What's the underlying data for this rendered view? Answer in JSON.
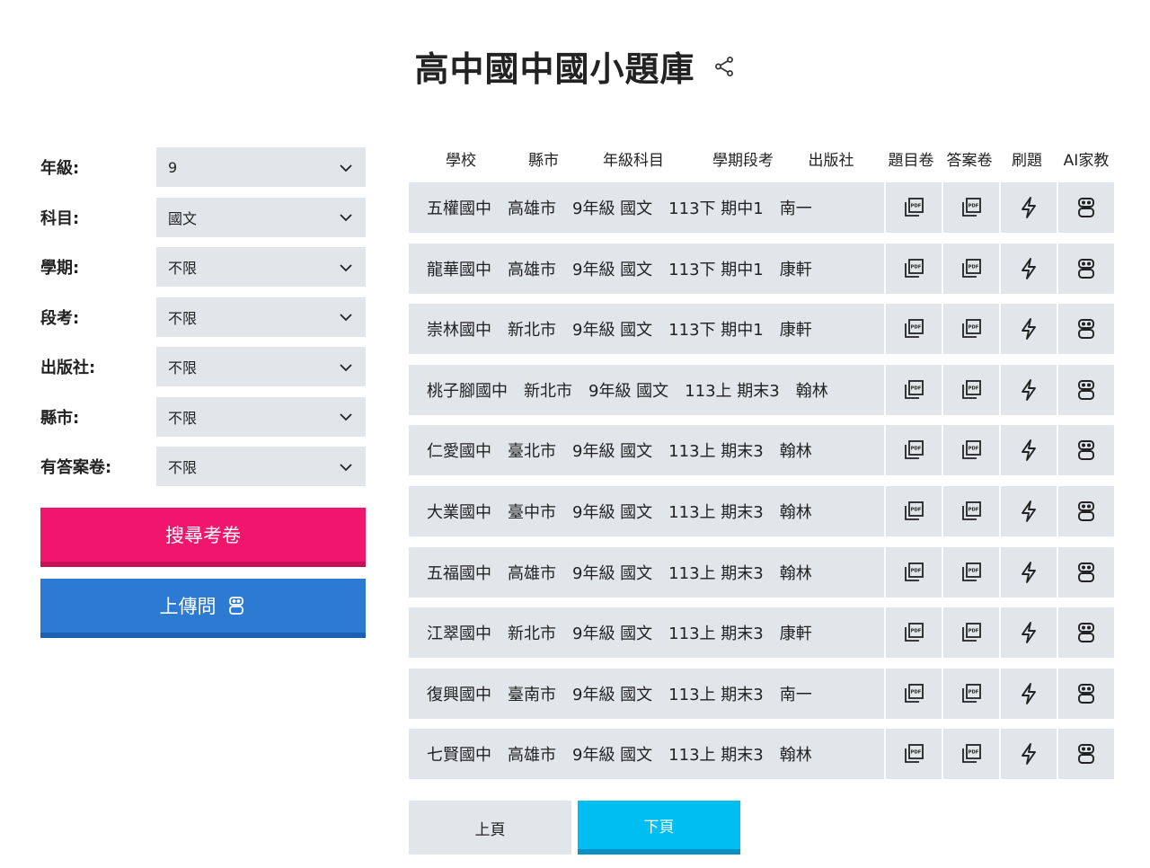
{
  "title": "高中國中國小題庫",
  "filters": [
    {
      "label": "年級:",
      "value": "9"
    },
    {
      "label": "科目:",
      "value": "國文"
    },
    {
      "label": "學期:",
      "value": "不限"
    },
    {
      "label": "段考:",
      "value": "不限"
    },
    {
      "label": "出版社:",
      "value": "不限"
    },
    {
      "label": "縣市:",
      "value": "不限"
    },
    {
      "label": "有答案卷:",
      "value": "不限"
    }
  ],
  "buttons": {
    "search": "搜尋考卷",
    "upload": "上傳問"
  },
  "columns": [
    "學校",
    "縣市",
    "年級科目",
    "學期段考",
    "出版社",
    "題目卷",
    "答案卷",
    "刷題",
    "AI家教"
  ],
  "rows": [
    "五權國中　高雄市　9年級 國文　113下 期中1　南一",
    "龍華國中　高雄市　9年級 國文　113下 期中1　康軒",
    "崇林國中　新北市　9年級 國文　113下 期中1　康軒",
    "桃子腳國中　新北市　9年級 國文　113上 期末3　翰林",
    "仁愛國中　臺北市　9年級 國文　113上 期末3　翰林",
    "大業國中　臺中市　9年級 國文　113上 期末3　翰林",
    "五福國中　高雄市　9年級 國文　113上 期末3　翰林",
    "江翠國中　新北市　9年級 國文　113上 期末3　康軒",
    "復興國中　臺南市　9年級 國文　113上 期末3　南一",
    "七賢國中　高雄市　9年級 國文　113上 期末3　翰林"
  ],
  "pager": {
    "prev": "上頁",
    "next": "下頁"
  },
  "colors": {
    "search": "#f0166e",
    "upload": "#2d7ad3",
    "next": "#00bff0",
    "cell": "#e2e5ea"
  },
  "icons": {
    "question_paper": "pdf-icon",
    "answer_paper": "pdf-icon",
    "practice": "lightning-icon",
    "ai_tutor": "robot-icon"
  }
}
